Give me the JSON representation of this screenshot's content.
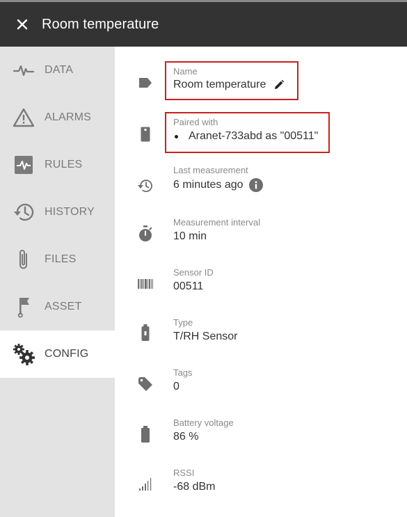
{
  "header": {
    "title": "Room temperature"
  },
  "sidebar": {
    "items": [
      {
        "label": "DATA",
        "icon": "pulse-icon"
      },
      {
        "label": "ALARMS",
        "icon": "warning-icon"
      },
      {
        "label": "RULES",
        "icon": "rules-icon"
      },
      {
        "label": "HISTORY",
        "icon": "history-icon"
      },
      {
        "label": "FILES",
        "icon": "paperclip-icon"
      },
      {
        "label": "ASSET",
        "icon": "flag-icon"
      },
      {
        "label": "CONFIG",
        "icon": "gears-icon",
        "active": true
      }
    ]
  },
  "config": {
    "name": {
      "label": "Name",
      "value": "Room temperature"
    },
    "paired": {
      "label": "Paired with",
      "value": "Aranet-733abd as \"00511\""
    },
    "last_measurement": {
      "label": "Last measurement",
      "value": "6 minutes ago"
    },
    "interval": {
      "label": "Measurement interval",
      "value": "10 min"
    },
    "sensor_id": {
      "label": "Sensor ID",
      "value": "00511"
    },
    "type": {
      "label": "Type",
      "value": "T/RH Sensor"
    },
    "tags": {
      "label": "Tags",
      "value": "0"
    },
    "battery": {
      "label": "Battery voltage",
      "value": "86 %"
    },
    "rssi": {
      "label": "RSSI",
      "value": "-68 dBm"
    }
  },
  "colors": {
    "header_bg": "#333333",
    "sidebar_bg": "#e3e3e3",
    "highlight": "#cc1f1f",
    "icon": "#6e6e6e"
  }
}
